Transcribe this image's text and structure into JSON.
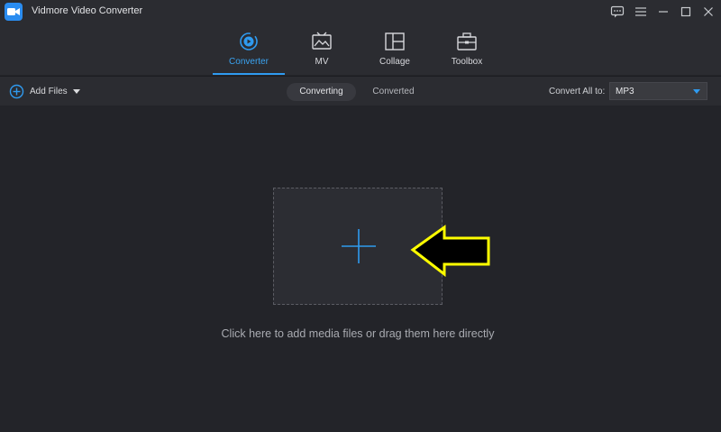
{
  "app": {
    "title": "Vidmore Video Converter"
  },
  "window_controls": [
    "feedback-icon",
    "menu-icon",
    "minimize-icon",
    "maximize-icon",
    "close-icon"
  ],
  "nav": {
    "tabs": [
      {
        "label": "Converter",
        "icon": "converter-icon",
        "active": true
      },
      {
        "label": "MV",
        "icon": "mv-icon",
        "active": false
      },
      {
        "label": "Collage",
        "icon": "collage-icon",
        "active": false
      },
      {
        "label": "Toolbox",
        "icon": "toolbox-icon",
        "active": false
      }
    ]
  },
  "toolbar": {
    "add_files_label": "Add Files",
    "segments": [
      {
        "label": "Converting",
        "active": true
      },
      {
        "label": "Converted",
        "active": false
      }
    ],
    "convert_all_label": "Convert All to:",
    "format_value": "MP3"
  },
  "main": {
    "hint": "Click here to add media files or drag them here directly"
  },
  "colors": {
    "background": "#232429",
    "bar": "#2b2c31",
    "accent": "#2f9bf0",
    "annotation": "#ffff00"
  }
}
